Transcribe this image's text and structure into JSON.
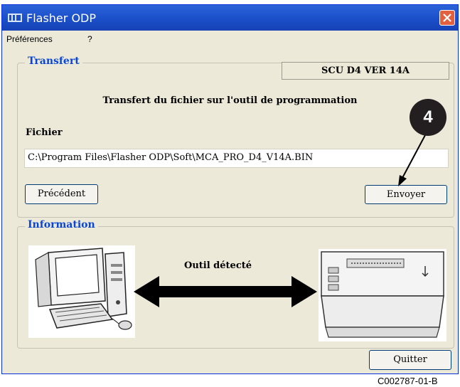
{
  "window": {
    "title": "Flasher ODP"
  },
  "menu": {
    "items": [
      "Préférences",
      "?"
    ]
  },
  "transfer": {
    "legend": "Transfert",
    "version": "SCU D4 VER  14A",
    "heading": "Transfert du fichier sur l'outil de programmation",
    "file_label": "Fichier",
    "file_path": "C:\\Program Files\\Flasher ODP\\Soft\\MCA_PRO_D4_V14A.BIN",
    "prev_label": "Précédent",
    "send_label": "Envoyer"
  },
  "callout": {
    "number": "4"
  },
  "information": {
    "legend": "Information",
    "status": "Outil détecté",
    "quit_label": "Quitter"
  },
  "footer": {
    "code": "C002787-01-B"
  },
  "colors": {
    "titlebar": "#1a4fc9",
    "legend": "#0a46d5",
    "window_bg": "#ece9d8",
    "close": "#e2603d"
  }
}
